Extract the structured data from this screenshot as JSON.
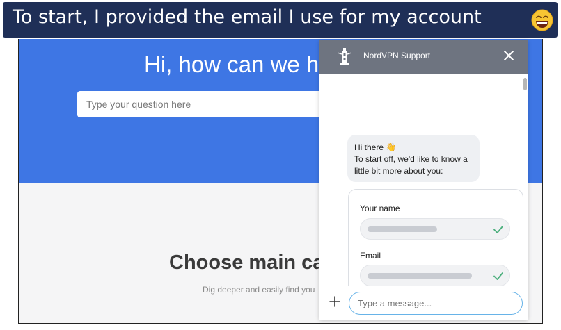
{
  "caption": {
    "text": "To start, I provided the email I use for my account",
    "emoji_icon": "grinning-face-emoji"
  },
  "page": {
    "hero_title": "Hi, how can we h",
    "search_placeholder": "Type your question here",
    "section_title": "Choose main ca",
    "section_subtitle": "Dig deeper and easily find you",
    "accent_color": "#3e76e4"
  },
  "chat": {
    "title": "NordVPN Support",
    "header_color": "#6e7480",
    "greeting_lines": [
      "Hi there 👋",
      "To start off, we'd like to know a",
      "little bit more about you:"
    ],
    "form": {
      "name_label": "Your name",
      "email_label": "Email"
    },
    "message_placeholder": "Type a message...",
    "icons": {
      "logo": "lighthouse-logo-icon",
      "close": "close-icon",
      "check": "check-icon",
      "attach": "plus-icon"
    }
  }
}
